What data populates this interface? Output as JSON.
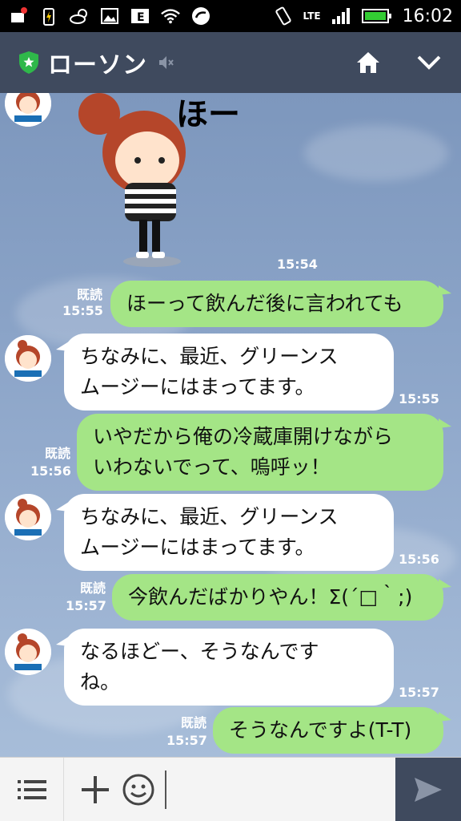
{
  "status_bar": {
    "time": "16:02",
    "network": "LTE"
  },
  "header": {
    "title": "ローソン"
  },
  "sticker": {
    "text": "ほー",
    "time": "15:54"
  },
  "read_label": "既読",
  "messages": [
    {
      "dir": "out",
      "read": "既読",
      "time": "15:55",
      "lines": [
        "ほーって飲んだ後に言われても"
      ]
    },
    {
      "dir": "in",
      "time": "15:55",
      "lines": [
        "ちなみに、最近、グリーンス",
        "ムージーにはまってます。"
      ]
    },
    {
      "dir": "out",
      "read": "既読",
      "time": "15:56",
      "lines": [
        "いやだから俺の冷蔵庫開けながら",
        "いわないでって、嗚呼ッ！"
      ]
    },
    {
      "dir": "in",
      "time": "15:56",
      "lines": [
        "ちなみに、最近、グリーンス",
        "ムージーにはまってます。"
      ]
    },
    {
      "dir": "out",
      "read": "既読",
      "time": "15:57",
      "lines": [
        "今飲んだばかりやん！Σ(´□｀;)"
      ]
    },
    {
      "dir": "in",
      "time": "15:57",
      "lines": [
        "なるほどー、そうなんです",
        "ね。"
      ]
    },
    {
      "dir": "out",
      "read": "既読",
      "time": "15:57",
      "lines": [
        "そうなんですよ(T-T)"
      ]
    }
  ],
  "avatar_label": "LAWSON",
  "input": {
    "value": "",
    "placeholder": ""
  },
  "colors": {
    "header": "#3f4a5e",
    "bubble_out": "#a4e586",
    "bubble_in": "#ffffff"
  }
}
